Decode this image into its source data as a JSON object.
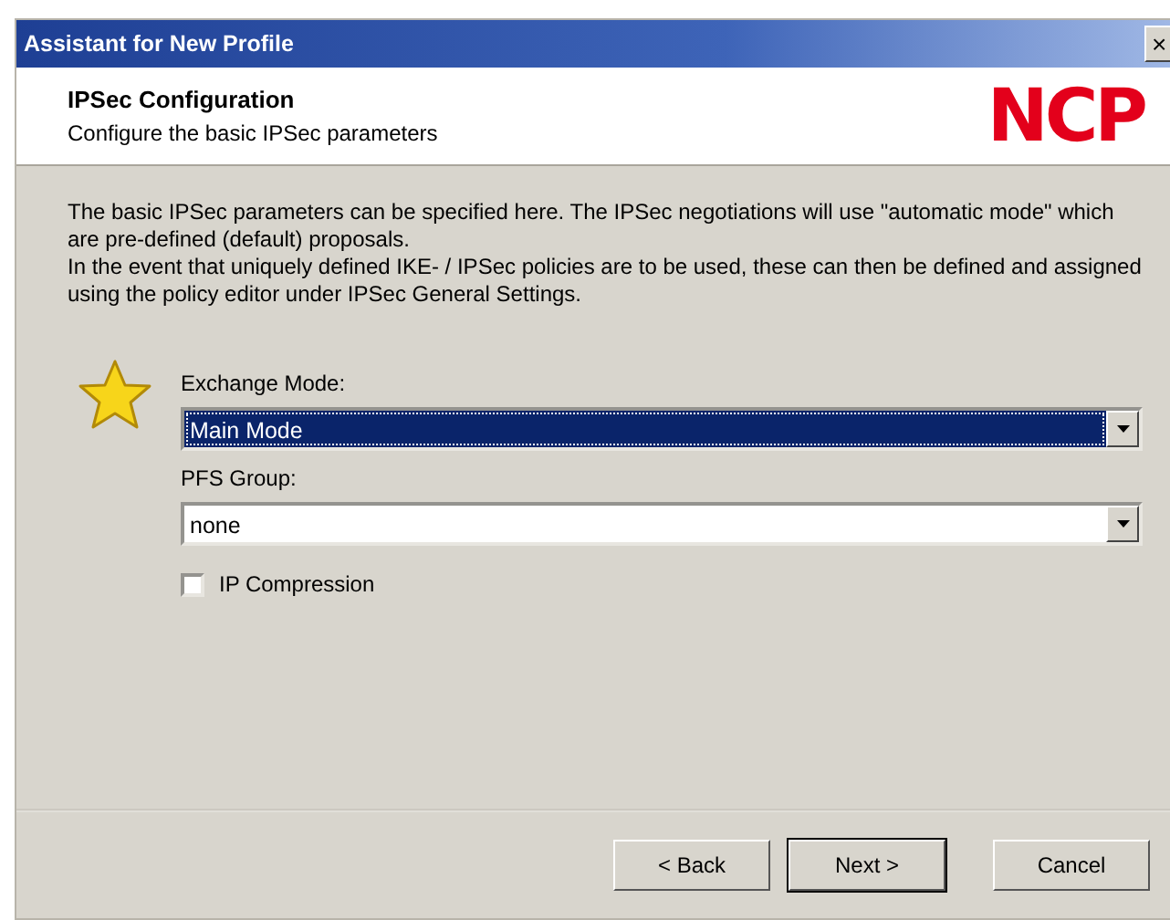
{
  "window": {
    "title": "Assistant for New Profile",
    "close": "×"
  },
  "header": {
    "title": "IPSec Configuration",
    "subtitle": "Configure the basic IPSec parameters",
    "logo": "NCP"
  },
  "description": [
    "The basic IPSec parameters can be specified here. The IPSec negotiations will use \"automatic mode\" which are pre-defined (default) proposals.",
    "In the event that uniquely defined IKE- / IPSec policies are to be used, these can then be defined and assigned using the policy editor under IPSec General Settings."
  ],
  "fields": [
    {
      "label": "Exchange Mode:",
      "value": "Main Mode",
      "focused": true
    },
    {
      "label": "PFS Group:",
      "value": "none",
      "focused": false
    }
  ],
  "checkbox": {
    "label": "IP Compression",
    "checked": false
  },
  "buttons": [
    {
      "label": "< Back",
      "default": false
    },
    {
      "label": "Next >",
      "default": true
    },
    {
      "label": "Cancel",
      "default": false
    }
  ]
}
